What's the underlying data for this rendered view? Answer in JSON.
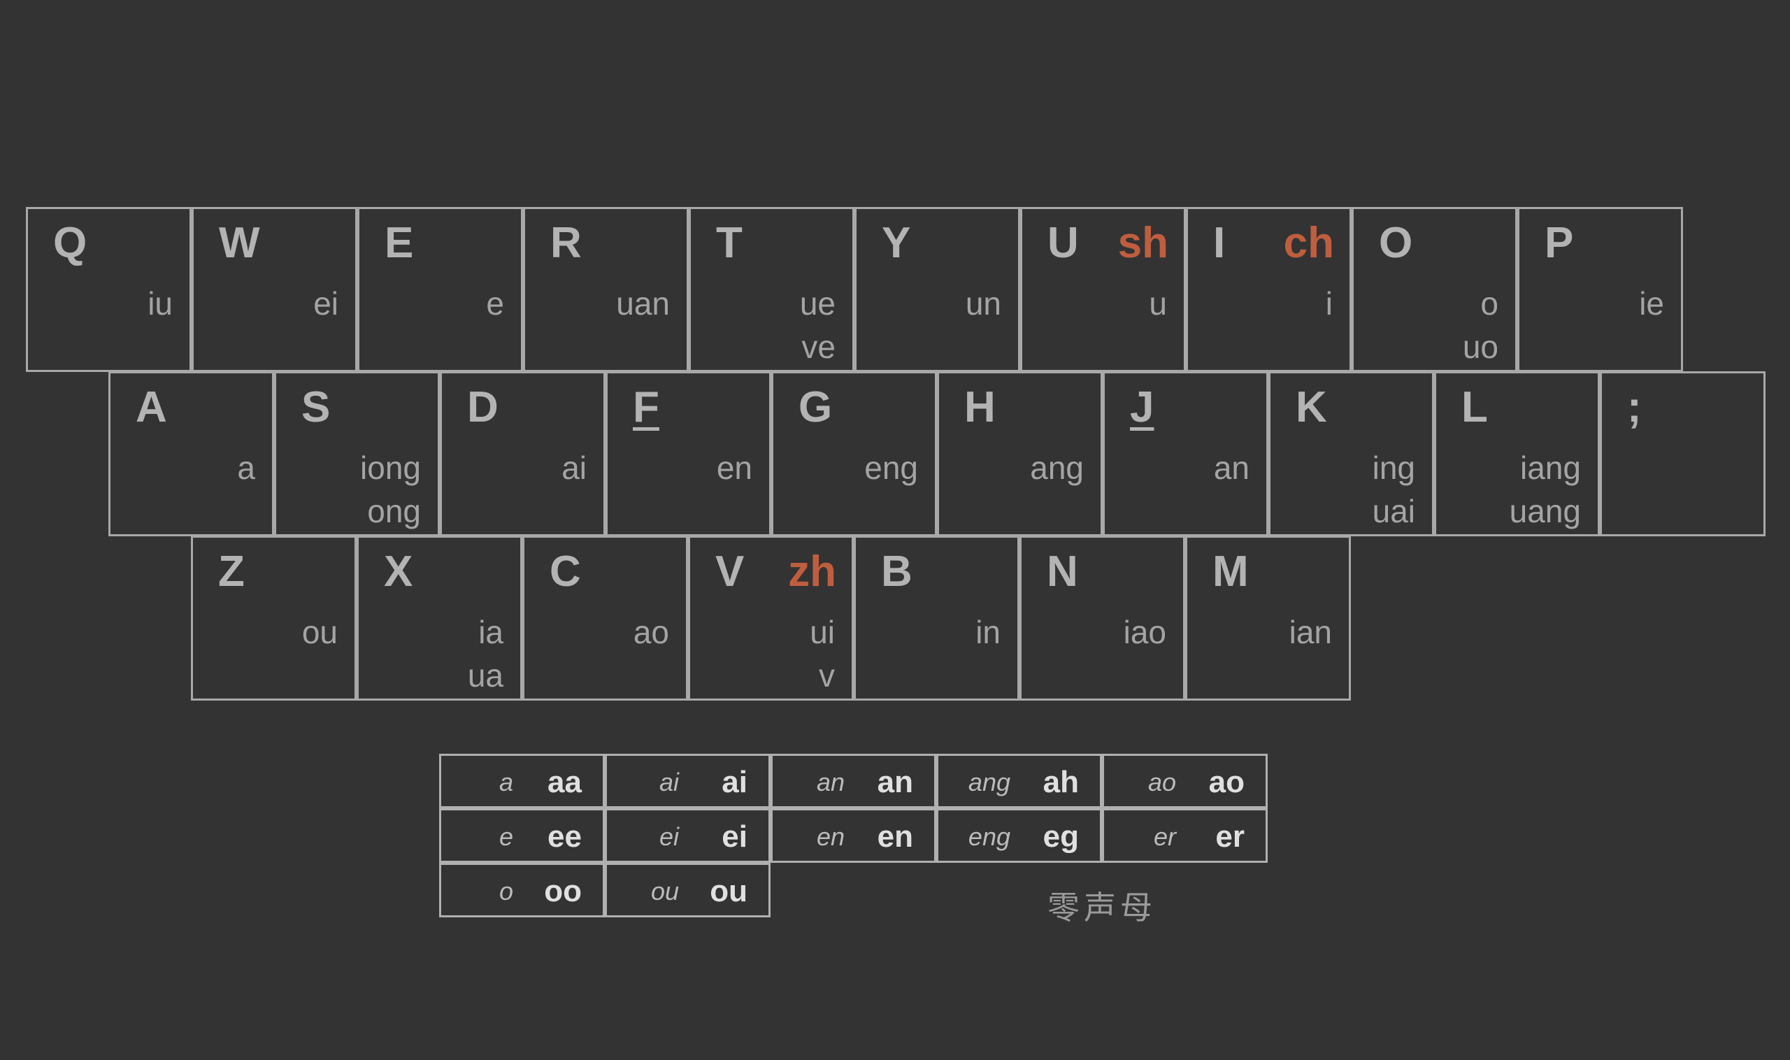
{
  "colors": {
    "background": "#333333",
    "key_border": "#a8a8a8",
    "letter": "#b3b3b3",
    "shengmu_accent": "#bf5e3f",
    "finals": "#a4a4a4"
  },
  "keyboard": {
    "rows": [
      {
        "keys": [
          {
            "letter": "Q",
            "finals": [
              "iu"
            ]
          },
          {
            "letter": "W",
            "finals": [
              "ei"
            ]
          },
          {
            "letter": "E",
            "finals": [
              "e"
            ]
          },
          {
            "letter": "R",
            "finals": [
              "uan"
            ]
          },
          {
            "letter": "T",
            "finals": [
              "ue",
              "ve"
            ]
          },
          {
            "letter": "Y",
            "finals": [
              "un"
            ]
          },
          {
            "letter": "U",
            "shengmu": "sh",
            "finals": [
              "u"
            ]
          },
          {
            "letter": "I",
            "shengmu": "ch",
            "finals": [
              "i"
            ]
          },
          {
            "letter": "O",
            "finals": [
              "o",
              "uo"
            ]
          },
          {
            "letter": "P",
            "finals": [
              "ie"
            ]
          }
        ]
      },
      {
        "keys": [
          {
            "letter": "A",
            "finals": [
              "a"
            ]
          },
          {
            "letter": "S",
            "finals": [
              "iong",
              "ong"
            ]
          },
          {
            "letter": "D",
            "finals": [
              "ai"
            ]
          },
          {
            "letter": "F",
            "underline": true,
            "finals": [
              "en"
            ]
          },
          {
            "letter": "G",
            "finals": [
              "eng"
            ]
          },
          {
            "letter": "H",
            "finals": [
              "ang"
            ]
          },
          {
            "letter": "J",
            "underline": true,
            "finals": [
              "an"
            ]
          },
          {
            "letter": "K",
            "finals": [
              "ing",
              "uai"
            ]
          },
          {
            "letter": "L",
            "finals": [
              "iang",
              "uang"
            ]
          },
          {
            "letter": ";",
            "finals": []
          }
        ]
      },
      {
        "keys": [
          {
            "letter": "Z",
            "finals": [
              "ou"
            ]
          },
          {
            "letter": "X",
            "finals": [
              "ia",
              "ua"
            ]
          },
          {
            "letter": "C",
            "finals": [
              "ao"
            ]
          },
          {
            "letter": "V",
            "shengmu": "zh",
            "finals": [
              "ui",
              "v"
            ]
          },
          {
            "letter": "B",
            "finals": [
              "in"
            ]
          },
          {
            "letter": "N",
            "finals": [
              "iao"
            ]
          },
          {
            "letter": "M",
            "finals": [
              "ian"
            ]
          }
        ]
      }
    ]
  },
  "zero_initial": {
    "caption": "零声母",
    "rows": [
      [
        {
          "syllable": "a",
          "code": "aa"
        },
        {
          "syllable": "ai",
          "code": "ai"
        },
        {
          "syllable": "an",
          "code": "an"
        },
        {
          "syllable": "ang",
          "code": "ah"
        },
        {
          "syllable": "ao",
          "code": "ao"
        }
      ],
      [
        {
          "syllable": "e",
          "code": "ee"
        },
        {
          "syllable": "ei",
          "code": "ei"
        },
        {
          "syllable": "en",
          "code": "en"
        },
        {
          "syllable": "eng",
          "code": "eg"
        },
        {
          "syllable": "er",
          "code": "er"
        }
      ],
      [
        {
          "syllable": "o",
          "code": "oo"
        },
        {
          "syllable": "ou",
          "code": "ou"
        }
      ]
    ]
  }
}
